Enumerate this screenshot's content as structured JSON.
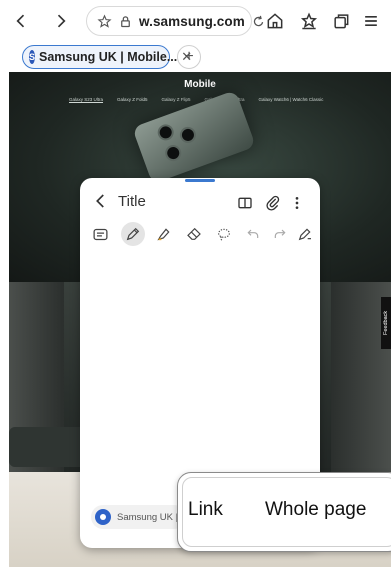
{
  "browser": {
    "url": "w.samsung.com",
    "tab": {
      "title": "Samsung UK | Mobile...",
      "favicon_letter": "S"
    },
    "new_tab_label": "+"
  },
  "website": {
    "title": "Mobile",
    "nav": [
      "Galaxy S23 Ultra",
      "Galaxy Z Fold5",
      "Galaxy Z Flip5",
      "Galaxy Tab S9 Ultra",
      "Galaxy Watch6 | Watch6 Classic"
    ],
    "feedback_label": "Feedback"
  },
  "notes": {
    "title": "Title",
    "link_label": "Samsung UK |"
  },
  "popup": {
    "link": "Link",
    "whole_page": "Whole page"
  },
  "colors": {
    "accent": "#3b79cf",
    "favicon": "#2b58b8"
  }
}
